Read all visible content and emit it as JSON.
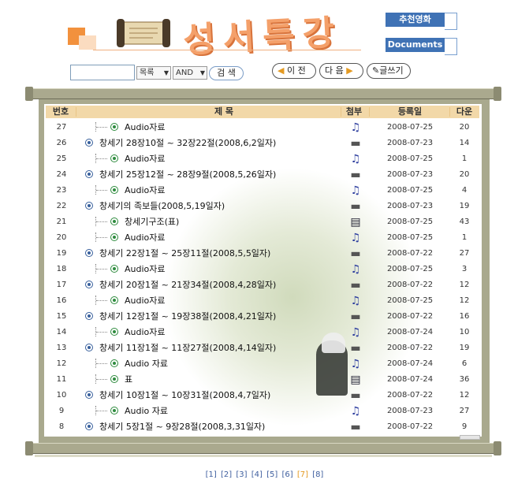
{
  "header": {
    "title": "성서특강",
    "side_buttons": [
      "추천영화",
      "Documents"
    ]
  },
  "search": {
    "input_value": "",
    "field_select": "목록",
    "op_select": "AND",
    "button": "검 색"
  },
  "nav": {
    "prev": "이 전",
    "next": "다 음",
    "write": "글쓰기"
  },
  "table": {
    "headers": {
      "num": "번호",
      "title": "제 목",
      "att": "첨부",
      "date": "등록일",
      "count": "다운"
    },
    "rows": [
      {
        "num": "27",
        "title": "Audio자료",
        "child": true,
        "att": "audio",
        "date": "2008-07-25",
        "count": "20"
      },
      {
        "num": "26",
        "title": "창세기 28장10절 ~ 32장22절(2008,6,2일자)",
        "child": false,
        "att": "disk",
        "date": "2008-07-23",
        "count": "14"
      },
      {
        "num": "25",
        "title": "Audio자료",
        "child": true,
        "att": "audio",
        "date": "2008-07-25",
        "count": "1"
      },
      {
        "num": "24",
        "title": "창세기 25장12절 ~ 28장9절(2008,5,26일자)",
        "child": false,
        "att": "disk",
        "date": "2008-07-23",
        "count": "20"
      },
      {
        "num": "23",
        "title": "Audio자료",
        "child": true,
        "att": "audio",
        "date": "2008-07-25",
        "count": "4"
      },
      {
        "num": "22",
        "title": "창세기의 족보들(2008,5,19일자)",
        "child": false,
        "att": "disk",
        "date": "2008-07-23",
        "count": "19"
      },
      {
        "num": "21",
        "title": "창세기구조(표)",
        "child": true,
        "att": "doc",
        "date": "2008-07-25",
        "count": "43"
      },
      {
        "num": "20",
        "title": "Audio자료",
        "child": true,
        "att": "audio",
        "date": "2008-07-25",
        "count": "1"
      },
      {
        "num": "19",
        "title": "창세기 22장1절 ~ 25장11절(2008,5,5일자)",
        "child": false,
        "att": "disk",
        "date": "2008-07-22",
        "count": "27"
      },
      {
        "num": "18",
        "title": "Audio자료",
        "child": true,
        "att": "audio",
        "date": "2008-07-25",
        "count": "3"
      },
      {
        "num": "17",
        "title": "창세기 20장1절 ~ 21장34절(2008,4,28일자)",
        "child": false,
        "att": "disk",
        "date": "2008-07-22",
        "count": "12"
      },
      {
        "num": "16",
        "title": "Audio자료",
        "child": true,
        "att": "audio",
        "date": "2008-07-25",
        "count": "12"
      },
      {
        "num": "15",
        "title": "창세기 12장1절 ~ 19장38절(2008,4,21일자)",
        "child": false,
        "att": "disk",
        "date": "2008-07-22",
        "count": "16"
      },
      {
        "num": "14",
        "title": "Audio자료",
        "child": true,
        "att": "audio",
        "date": "2008-07-24",
        "count": "10"
      },
      {
        "num": "13",
        "title": "창세기 11장1절 ~ 11장27절(2008,4,14일자)",
        "child": false,
        "att": "disk",
        "date": "2008-07-22",
        "count": "19"
      },
      {
        "num": "12",
        "title": "Audio 자료",
        "child": true,
        "att": "audio",
        "date": "2008-07-24",
        "count": "6"
      },
      {
        "num": "11",
        "title": "표",
        "child": true,
        "att": "doc",
        "date": "2008-07-24",
        "count": "36"
      },
      {
        "num": "10",
        "title": "창세기 10장1절 ~ 10장31절(2008,4,7일자)",
        "child": false,
        "att": "disk",
        "date": "2008-07-22",
        "count": "12"
      },
      {
        "num": "9",
        "title": "Audio 자료",
        "child": true,
        "att": "audio",
        "date": "2008-07-23",
        "count": "27"
      },
      {
        "num": "8",
        "title": "창세기 5장1절 ~ 9장28절(2008,3,31일자)",
        "child": false,
        "att": "disk",
        "date": "2008-07-22",
        "count": "9"
      }
    ]
  },
  "pager": {
    "pages": [
      "[1]",
      "[2]",
      "[3]",
      "[4]",
      "[5]",
      "[6]",
      "[7]",
      "[8]"
    ],
    "current": "[7]"
  },
  "colors": {
    "accent_orange": "#f2913d",
    "button_blue": "#3f72b5",
    "header_row": "#f2d8a8",
    "frame": "#a9a98e"
  }
}
